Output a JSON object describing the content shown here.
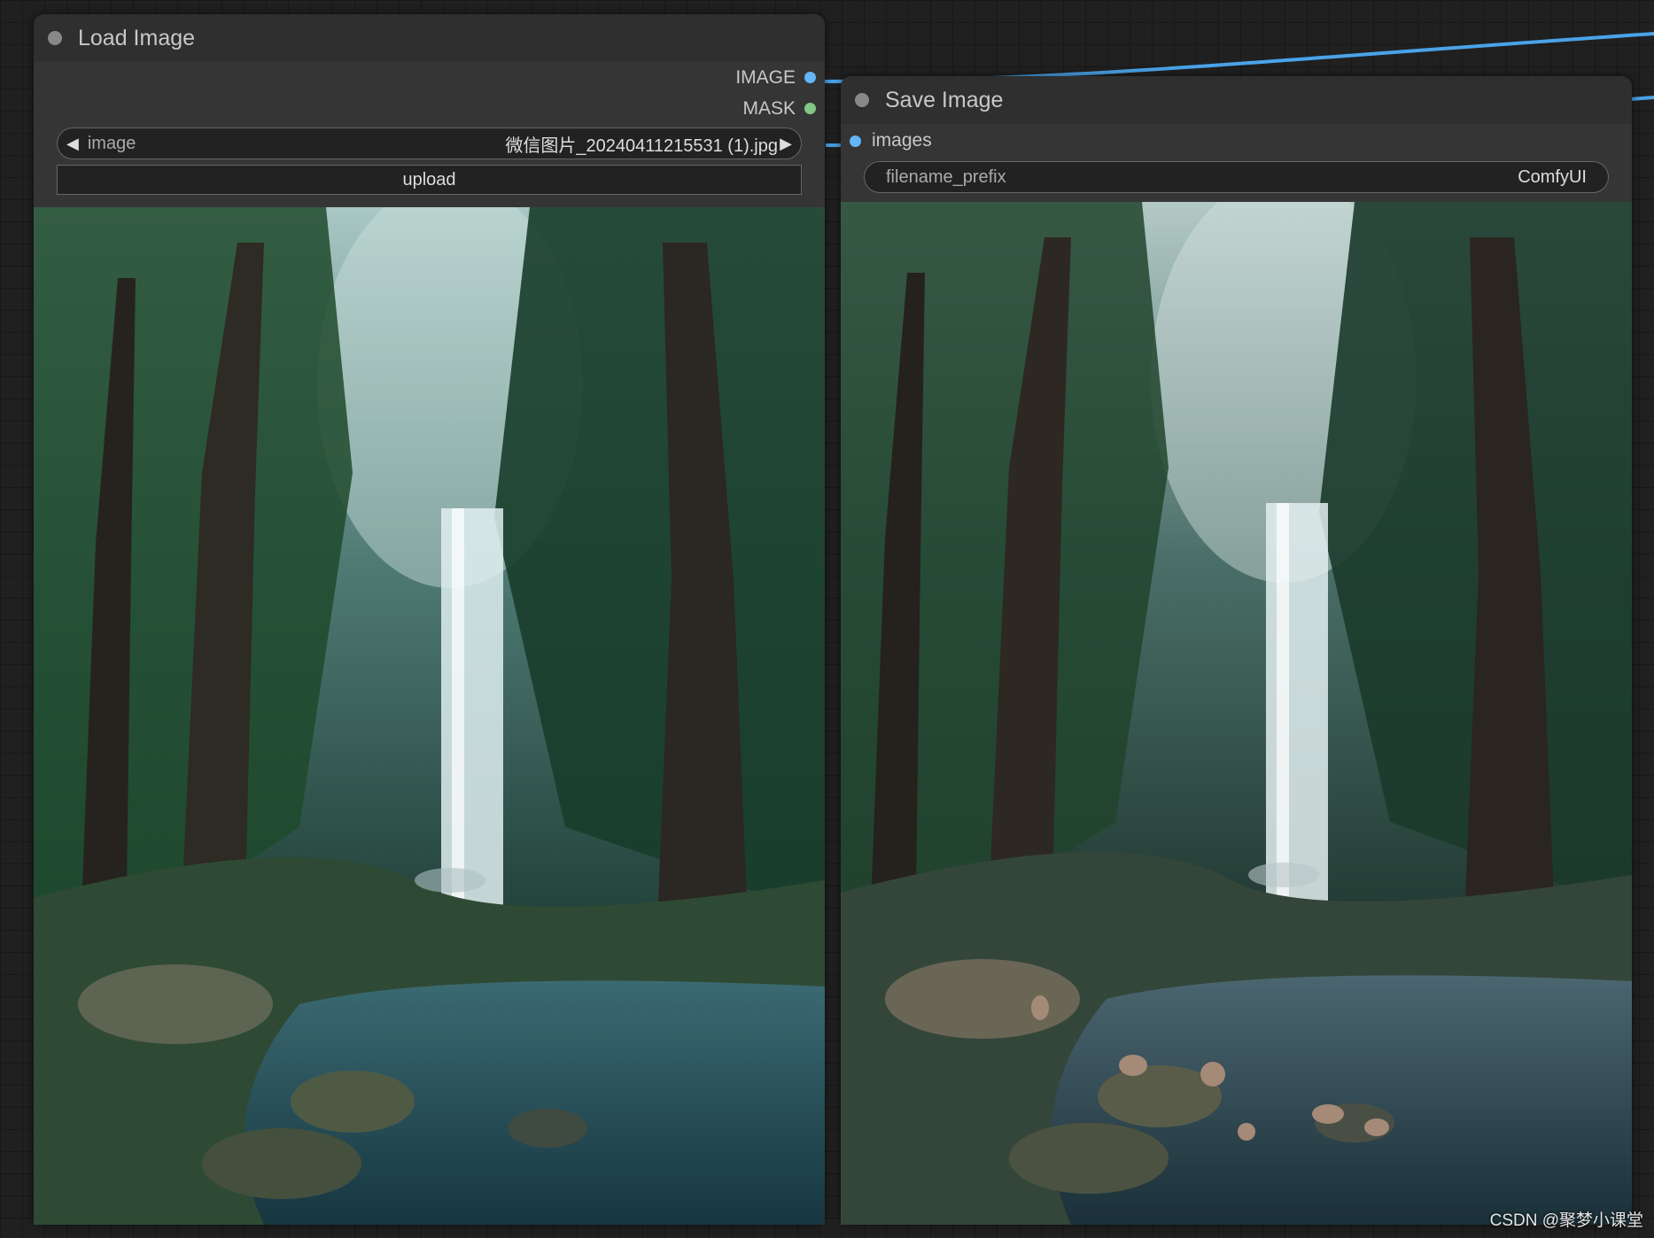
{
  "load_node": {
    "title": "Load Image",
    "outputs": [
      {
        "label": "IMAGE",
        "color": "#64b5f6"
      },
      {
        "label": "MASK",
        "color": "#81c784"
      }
    ],
    "image_widget": {
      "label": "image",
      "value": "微信图片_20240411215531 (1).jpg"
    },
    "upload_label": "upload"
  },
  "save_node": {
    "title": "Save Image",
    "input": {
      "label": "images",
      "color": "#64b5f6"
    },
    "prefix_widget": {
      "label": "filename_prefix",
      "value": "ComfyUI"
    }
  },
  "watermark": "CSDN @聚梦小课堂",
  "colors": {
    "link": "#4aa3e8",
    "canvas": "#202020",
    "node_body": "#353535"
  }
}
